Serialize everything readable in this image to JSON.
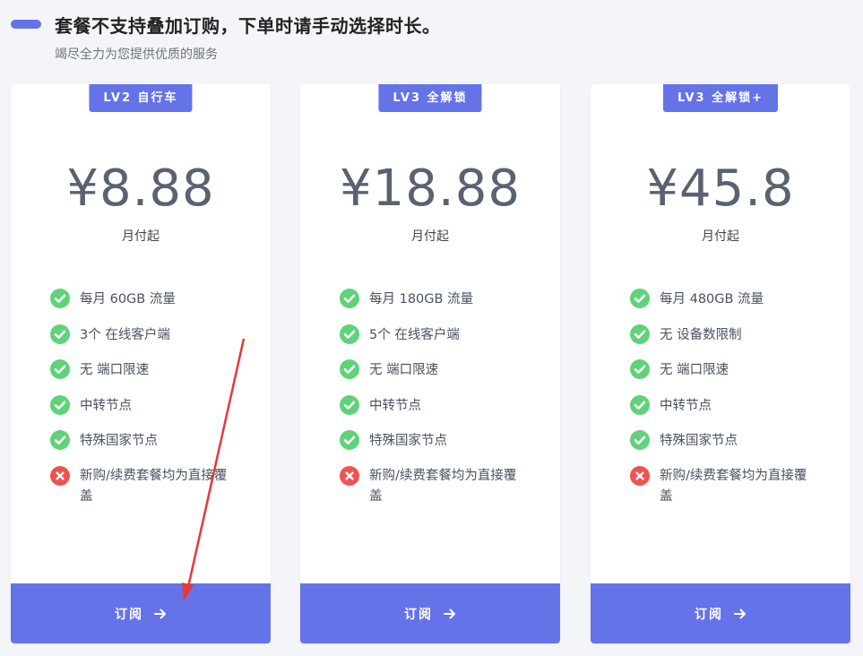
{
  "header": {
    "title": "套餐不支持叠加订购，下单时请手动选择时长。",
    "subtitle": "竭尽全力为您提供优质的服务"
  },
  "colors": {
    "accent": "#6573e8",
    "check": "#5fd27a",
    "cross": "#ef5350"
  },
  "plans": [
    {
      "badge": "LV2 自行车",
      "price": "¥8.88",
      "period": "月付起",
      "features": [
        {
          "text": "每月 60GB 流量",
          "included": true
        },
        {
          "text": "3个 在线客户端",
          "included": true
        },
        {
          "text": "无 端口限速",
          "included": true
        },
        {
          "text": "中转节点",
          "included": true
        },
        {
          "text": "特殊国家节点",
          "included": true
        },
        {
          "text": "新购/续费套餐均为直接覆盖",
          "included": false
        }
      ],
      "button_label": "订阅"
    },
    {
      "badge": "LV3 全解锁",
      "price": "¥18.88",
      "period": "月付起",
      "features": [
        {
          "text": "每月 180GB 流量",
          "included": true
        },
        {
          "text": "5个 在线客户端",
          "included": true
        },
        {
          "text": "无 端口限速",
          "included": true
        },
        {
          "text": "中转节点",
          "included": true
        },
        {
          "text": "特殊国家节点",
          "included": true
        },
        {
          "text": "新购/续费套餐均为直接覆盖",
          "included": false
        }
      ],
      "button_label": "订阅"
    },
    {
      "badge": "LV3 全解锁+",
      "price": "¥45.8",
      "period": "月付起",
      "features": [
        {
          "text": "每月 480GB 流量",
          "included": true
        },
        {
          "text": "无 设备数限制",
          "included": true
        },
        {
          "text": "无 端口限速",
          "included": true
        },
        {
          "text": "中转节点",
          "included": true
        },
        {
          "text": "特殊国家节点",
          "included": true
        },
        {
          "text": "新购/续费套餐均为直接覆盖",
          "included": false
        }
      ],
      "button_label": "订阅"
    }
  ]
}
